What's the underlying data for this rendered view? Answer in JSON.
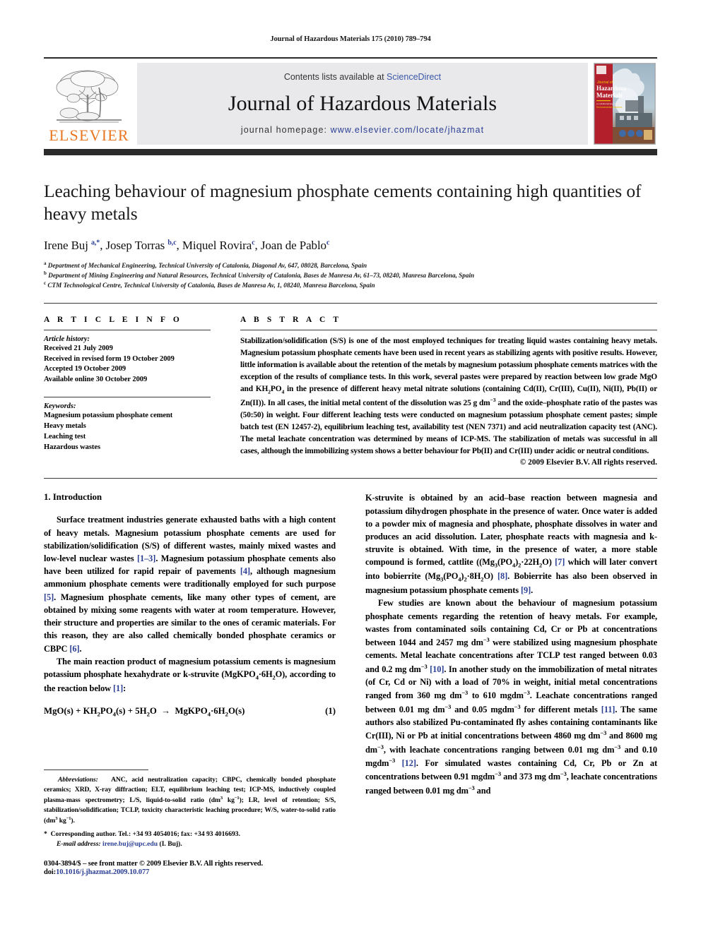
{
  "running_head": "Journal of Hazardous Materials 175 (2010) 789–794",
  "masthead": {
    "publisher_name": "ELSEVIER",
    "publisher_logo_alt": "elsevier-tree-logo",
    "contents_prefix": "Contents lists available at ",
    "contents_link": "ScienceDirect",
    "journal_title": "Journal of Hazardous Materials",
    "homepage_prefix": "journal homepage: ",
    "homepage_url": "www.elsevier.com/locate/jhazmat",
    "cover": {
      "line1": "Journal of",
      "line2": "Hazardous",
      "line3": "Materials",
      "sub1": "a multidisciplinary journal of hazard assessment",
      "sub2": "Environmental Solutions"
    },
    "colors": {
      "banner_bg": "#e9e9eb",
      "rule_dark": "#2b2b2b",
      "elsevier_orange": "#E87722",
      "link_blue": "#2b3f94",
      "cover_red": "#b3202c"
    }
  },
  "article": {
    "title": "Leaching behaviour of magnesium phosphate cements containing high quantities of heavy metals",
    "authors_html": "Irene Buj <sup>a,*</sup>, Josep Torras <sup>b,c</sup>, Miquel Rovira<sup>c</sup>, Joan de Pablo<sup>c</sup>",
    "affiliations": [
      {
        "marker": "a",
        "text": "Department of Mechanical Engineering, Technical University of Catalonia, Diagonal Av, 647, 08028, Barcelona, Spain"
      },
      {
        "marker": "b",
        "text": "Department of Mining Engineering and Natural Resources, Technical University of Catalonia, Bases de Manresa Av, 61–73, 08240, Manresa Barcelona, Spain"
      },
      {
        "marker": "c",
        "text": "CTM Technological Centre, Technical University of Catalonia, Bases de Manresa Av, 1, 08240, Manresa Barcelona, Spain"
      }
    ]
  },
  "article_info": {
    "heading": "A R T I C L E   I N F O",
    "history_label": "Article history:",
    "history": [
      "Received 21 July 2009",
      "Received in revised form 19 October 2009",
      "Accepted 19 October 2009",
      "Available online 30 October 2009"
    ],
    "keywords_label": "Keywords:",
    "keywords": [
      "Magnesium potassium phosphate cement",
      "Heavy metals",
      "Leaching test",
      "Hazardous wastes"
    ]
  },
  "abstract": {
    "heading": "A B S T R A C T",
    "body_html": "Stabilization/solidification (S/S) is one of the most employed techniques for treating liquid wastes containing heavy metals. Magnesium potassium phosphate cements have been used in recent years as stabilizing agents with positive results. However, little information is available about the retention of the metals by magnesium potassium phosphate cements matrices with the exception of the results of compliance tests. In this work, several pastes were prepared by reaction between low grade MgO and KH<sub>2</sub>PO<sub>4</sub> in the presence of different heavy metal nitrate solutions (containing Cd(II), Cr(III), Cu(II), Ni(II), Pb(II) or Zn(II)). In all cases, the initial metal content of the dissolution was 25 g dm<sup>−3</sup> and the oxide–phosphate ratio of the pastes was (50:50) in weight. Four different leaching tests were conducted on magnesium potassium phosphate cement pastes; simple batch test (EN 12457-2), equilibrium leaching test, availability test (NEN 7371) and acid neutralization capacity test (ANC). The metal leachate concentration was determined by means of ICP-MS. The stabilization of metals was successful in all cases, although the immobilizing system shows a better behaviour for Pb(II) and Cr(III) under acidic or neutral conditions.",
    "copyright": "© 2009 Elsevier B.V. All rights reserved."
  },
  "body": {
    "section_number_title": "1.  Introduction",
    "left_paragraphs_html": [
      "Surface treatment industries generate exhausted baths with a high content of heavy metals. Magnesium potassium phosphate cements are used for stabilization/solidification (S/S) of different wastes, mainly mixed wastes and low-level nuclear wastes <span class=\"ref\">[1–3]</span>. Magnesium potassium phosphate cements also have been utilized for rapid repair of pavements <span class=\"ref\">[4]</span>, although magnesium ammonium phosphate cements were traditionally employed for such purpose <span class=\"ref\">[5]</span>. Magnesium phosphate cements, like many other types of cement, are obtained by mixing some reagents with water at room temperature. However, their structure and properties are similar to the ones of ceramic materials. For this reason, they are also called chemically bonded phosphate ceramics or CBPC <span class=\"ref\">[6]</span>.",
      "The main reaction product of magnesium potassium cements is magnesium potassium phosphate hexahydrate or k-struvite (MgKPO<sub>4</sub>·6H<sub>2</sub>O), according to the reaction below <span class=\"ref\">[1]</span>:"
    ],
    "equation_html": "MgO(s) + KH<sub>2</sub>PO<sub>4</sub>(s) + 5H<sub>2</sub>O &nbsp;→&nbsp; MgKPO<sub>4</sub>·6H<sub>2</sub>O(s)",
    "equation_number": "(1)",
    "right_paragraphs_html": [
      "K-struvite is obtained by an acid–base reaction between magnesia and potassium dihydrogen phosphate in the presence of water. Once water is added to a powder mix of magnesia and phosphate, phosphate dissolves in water and produces an acid dissolution. Later, phosphate reacts with magnesia and k-struvite is obtained. With time, in the presence of water, a more stable compound is formed, cattlite ((Mg<sub>3</sub>(PO<sub>4</sub>)<sub>2</sub>·22H<sub>2</sub>O) <span class=\"ref\">[7]</span> which will later convert into bobierrite (Mg<sub>3</sub>(PO<sub>4</sub>)<sub>2</sub>·8H<sub>2</sub>O) <span class=\"ref\">[8]</span>. Bobierrite has also been observed in magnesium potassium phosphate cements <span class=\"ref\">[9]</span>.",
      "Few studies are known about the behaviour of magnesium potassium phosphate cements regarding the retention of heavy metals. For example, wastes from contaminated soils containing Cd, Cr or Pb at concentrations between 1044 and 2457 mg dm<sup>−3</sup> were stabilized using magnesium phosphate cements. Metal leachate concentrations after TCLP test ranged between 0.03 and 0.2 mg dm<sup>−3</sup> <span class=\"ref\">[10]</span>. In another study on the immobilization of metal nitrates (of Cr, Cd or Ni) with a load of 70% in weight, initial metal concentrations ranged from 360 mg dm<sup>−3</sup> to 610 mgdm<sup>−3</sup>. Leachate concentrations ranged between 0.01 mg dm<sup>−3</sup> and 0.05 mgdm<sup>−3</sup> for different metals <span class=\"ref\">[11]</span>. The same authors also stabilized Pu-contaminated fly ashes containing contaminants like Cr(III), Ni or Pb at initial concentrations between 4860 mg dm<sup>−3</sup> and 8600 mg dm<sup>−3</sup>, with leachate concentrations ranging between 0.01 mg dm<sup>−3</sup> and 0.10 mgdm<sup>−3</sup> <span class=\"ref\">[12]</span>. For simulated wastes containing Cd, Cr, Pb or Zn at concentrations between 0.91 mgdm<sup>−3</sup> and 373 mg dm<sup>−3</sup>, leachate concentrations ranged between 0.01 mg dm<sup>−3</sup> and"
    ]
  },
  "footnotes": {
    "abbreviations_html": "<i>Abbreviations:</i>&nbsp;&nbsp; ANC, acid neutralization capacity; CBPC, chemically bonded phosphate ceramics; XRD, X-ray diffraction; ELT, equilibrium leaching test; ICP-MS, inductively coupled plasma-mass spectrometry; L/S, liquid-to-solid ratio (dm<sup>3</sup> kg<sup>−1</sup>); LR, level of retention; S/S, stabilization/solidification; TCLP, toxicity characteristic leaching procedure; W/S, water-to-solid ratio (dm<sup>3</sup> kg<sup>−1</sup>).",
    "corresponding_html": "*&nbsp;&nbsp;Corresponding author. Tel.: +34 93 4054016; fax: +34 93 4016693.",
    "email_html": "<i>E-mail address:</i> <span class=\"email-link\">irene.buj@upc.edu</span> (I. Buj)."
  },
  "bottom": {
    "issn_line": "0304-3894/$ – see front matter © 2009 Elsevier B.V. All rights reserved.",
    "doi_prefix": "doi:",
    "doi_value": "10.1016/j.jhazmat.2009.10.077"
  }
}
